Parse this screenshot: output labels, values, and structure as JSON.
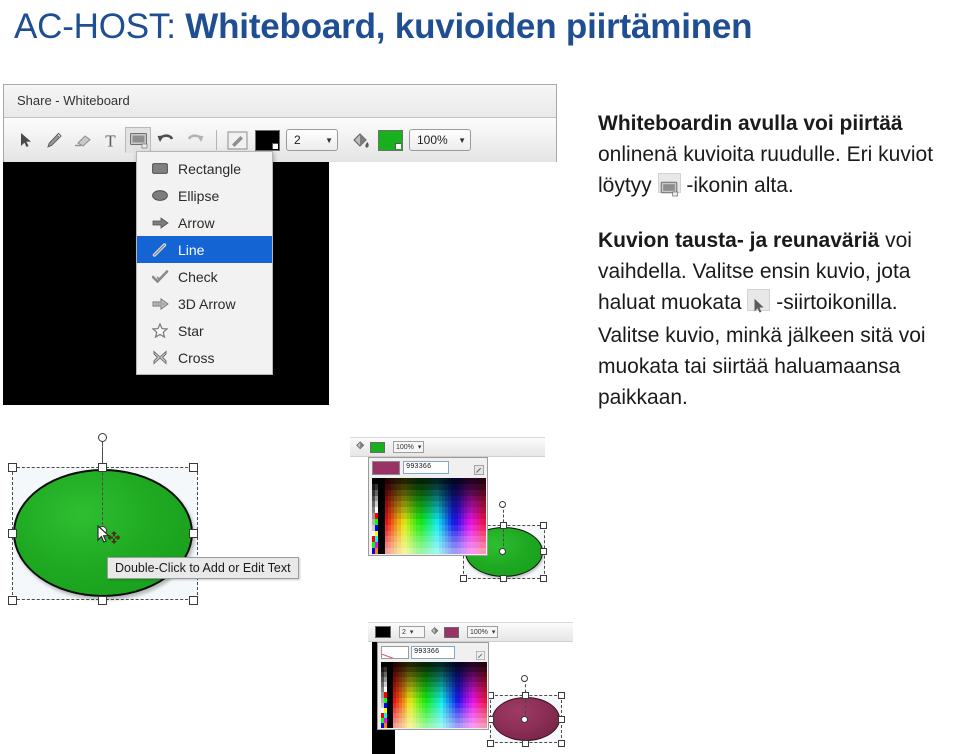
{
  "slide": {
    "title_light": "AC-HOST:",
    "title_bold": "Whiteboard, kuvioiden piirtäminen",
    "title_color": "#1F4E93"
  },
  "whiteboard_window": {
    "titlebar": "Share - Whiteboard",
    "toolbar": {
      "tools": [
        {
          "name": "select-arrow",
          "label": "Select"
        },
        {
          "name": "pencil",
          "label": "Pencil"
        },
        {
          "name": "eraser",
          "label": "Eraser"
        },
        {
          "name": "text",
          "label": "T"
        },
        {
          "name": "shape",
          "label": "Shape"
        },
        {
          "name": "undo",
          "label": "Undo"
        },
        {
          "name": "redo",
          "label": "Redo"
        }
      ],
      "stroke_tool_label": "Stroke color",
      "stroke_color": "#000000",
      "line_width": "2",
      "fill_tool_label": "Fill color",
      "fill_color": "#18b01c",
      "opacity": "100%"
    }
  },
  "shape_menu": {
    "selected": "Line",
    "items": [
      {
        "label": "Rectangle",
        "icon": "rectangle-icon"
      },
      {
        "label": "Ellipse",
        "icon": "ellipse-icon"
      },
      {
        "label": "Arrow",
        "icon": "arrow-icon"
      },
      {
        "label": "Line",
        "icon": "line-icon"
      },
      {
        "label": "Check",
        "icon": "check-icon"
      },
      {
        "label": "3D Arrow",
        "icon": "arrow-3d-icon"
      },
      {
        "label": "Star",
        "icon": "star-icon"
      },
      {
        "label": "Cross",
        "icon": "cross-icon"
      }
    ]
  },
  "body_text": {
    "p1_bold": "Whiteboardin avulla voi piirtää",
    "p1_rest_a": " onlinenä kuvioita ruudulle. Eri kuviot löytyy ",
    "p1_rest_b": " -ikonin alta.",
    "p2_bold": "Kuvion tausta- ja reunaväriä",
    "p2_rest_a": " voi vaihdella. Valitse ensin kuvio, jota haluat muokata ",
    "p2_rest_b": " -siirtoikonilla.",
    "p3": "Valitse kuvio, minkä jälkeen sitä voi muokata tai siirtää haluamaansa paikkaan."
  },
  "screenshot_green": {
    "tooltip": "Double-Click to Add or Edit Text",
    "shape_fill": "#1faa22",
    "cursor": "move-cursor"
  },
  "screenshot_picker": {
    "toolbar": {
      "fill_tool_label": "Fill",
      "fill_color": "#18b01c",
      "opacity": "100%"
    },
    "hex_value": "993366",
    "preview_color": "#993366",
    "shape_fill": "#1faa22"
  },
  "screenshot_bottom": {
    "toolbar": {
      "stroke_color": "#000000",
      "line_width": "2",
      "fill_color": "#993366",
      "opacity": "100%"
    },
    "hex_value": "993366",
    "shape_fill": "#8c2f57"
  }
}
